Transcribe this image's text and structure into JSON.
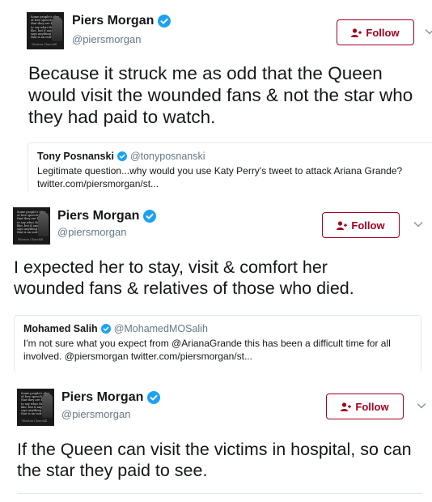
{
  "tweets": [
    {
      "author": {
        "name": "Piers Morgan",
        "handle": "@piersmorgan",
        "verified": true
      },
      "follow_label": "Follow",
      "text": "Because it struck me as odd that the Queen would visit the wounded fans & not the star who they had paid to watch.",
      "quote": {
        "name": "Tony Posnanski",
        "handle": "@tonyposnanski",
        "text": "Legitimate question...why would you use Katy Perry's tweet to attack Ariana Grande? twitter.com/piersmorgan/st..."
      }
    },
    {
      "author": {
        "name": "Piers Morgan",
        "handle": "@piersmorgan",
        "verified": true
      },
      "follow_label": "Follow",
      "text": "I expected her to stay, visit & comfort her wounded fans & relatives of those who died.",
      "quote": {
        "name": "Mohamed Salih",
        "handle": "@MohamedMOSalih",
        "text": "I'm not sure what you expect from @ArianaGrande this has been a difficult time for all involved. @piersmorgan twitter.com/piersmorgan/st..."
      }
    },
    {
      "author": {
        "name": "Piers Morgan",
        "handle": "@piersmorgan",
        "verified": true
      },
      "follow_label": "Follow",
      "text": "If the Queen can visit the victims in hospital, so can the star they paid to see."
    }
  ],
  "avatar_caption": "Some people's idea of free speech is that they are free to say what they like, but if anyone says anything back, that is an outrage.",
  "avatar_signature": "Winston Churchill",
  "colors": {
    "follow_accent": "#a3001f",
    "verified_blue": "#1da1f2",
    "secondary_text": "#657786",
    "border": "#e1e8ed"
  },
  "icons": [
    "verified-badge-icon",
    "follow-user-icon",
    "chevron-down-icon"
  ]
}
